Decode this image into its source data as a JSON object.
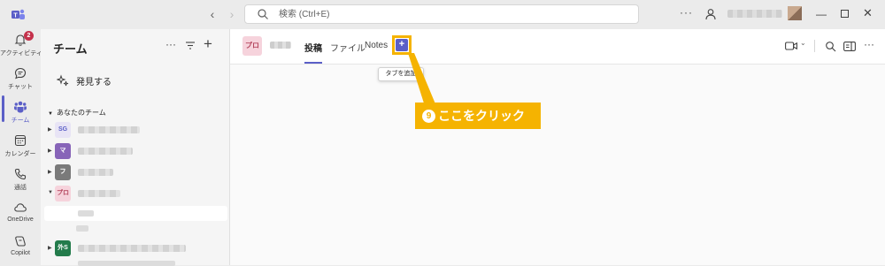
{
  "window": {
    "search_placeholder": "検索 (Ctrl+E)"
  },
  "rail": {
    "items": [
      {
        "label": "アクティビティ",
        "badge": "2",
        "icon": "bell-icon"
      },
      {
        "label": "チャット",
        "icon": "chat-icon"
      },
      {
        "label": "チーム",
        "icon": "teams-icon",
        "active": true
      },
      {
        "label": "カレンダー",
        "icon": "calendar-icon"
      },
      {
        "label": "通話",
        "icon": "phone-icon"
      },
      {
        "label": "OneDrive",
        "icon": "cloud-icon"
      },
      {
        "label": "Copilot",
        "icon": "copilot-icon"
      }
    ]
  },
  "panel": {
    "title": "チーム",
    "discover_label": "発見する",
    "section_label": "あなたのチーム",
    "teams": [
      {
        "initials": "SG",
        "color": "#e8e4f5",
        "text_color": "#5b5fc7"
      },
      {
        "initials": "マ",
        "color": "#8764b8",
        "text_color": "#ffffff"
      },
      {
        "initials": "フ",
        "color": "#7a7a7a",
        "text_color": "#ffffff"
      },
      {
        "initials": "プロ",
        "color": "#f6d3dc",
        "text_color": "#b4455d",
        "expanded": true
      },
      {
        "initials": "外S",
        "color": "#237b4b",
        "text_color": "#ffffff"
      }
    ]
  },
  "main": {
    "team_initials": "プロ",
    "tabs": [
      "投稿",
      "ファイル",
      "Notes"
    ],
    "active_tab": "投稿",
    "add_tab_tooltip": "タブを追加"
  },
  "callout": {
    "number": "9",
    "text": "ここをクリック",
    "color": "#f5b301"
  },
  "colors": {
    "accent": "#5b5fc7",
    "badge": "#c4314b"
  }
}
